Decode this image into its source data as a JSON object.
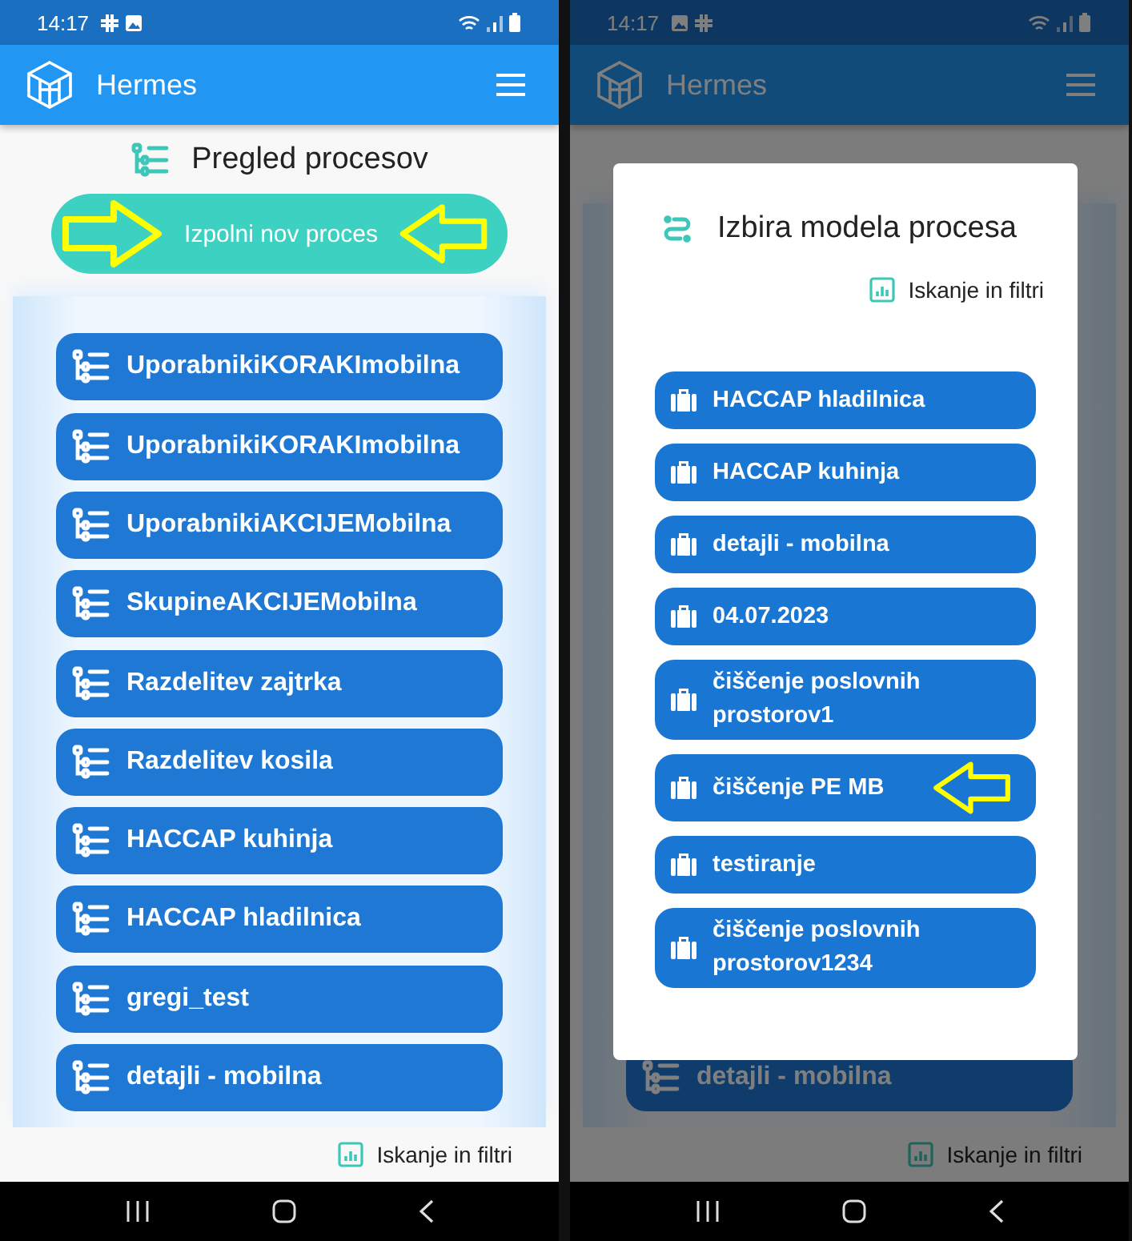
{
  "screens": [
    {
      "status_bar": {
        "time": "14:17",
        "notifications": [
          {
            "kind": "grid"
          },
          {
            "kind": "image"
          }
        ]
      },
      "app_bar": {
        "title": "Hermes"
      },
      "page_title": "Pregled procesov",
      "new_process_button": {
        "label": "Izpolni nov proces",
        "marked_with_arrows": true
      },
      "processes": [
        "UporabnikiKORAKImobilna",
        "UporabnikiKORAKImobilna",
        "UporabnikiAKCIJEMobilna",
        "SkupineAKCIJEMobilna",
        "Razdelitev zajtrka",
        "Razdelitev kosila",
        "HACCAP kuhinja",
        "HACCAP hladilnica",
        "gregi_test",
        "detajli - mobilna"
      ],
      "search_link": "Iskanje in filtri"
    },
    {
      "status_bar": {
        "time": "14:17",
        "notifications": [
          {
            "kind": "image"
          },
          {
            "kind": "grid"
          }
        ]
      },
      "app_bar": {
        "title": "Hermes"
      },
      "processes": [
        "detajli - mobilna"
      ],
      "search_link": "Iskanje in filtri",
      "dialog": {
        "title": "Izbira modela procesa",
        "search_link": "Iskanje in filtri",
        "models": [
          {
            "label": "HACCAP hladilnica",
            "marked_with_arrow": false
          },
          {
            "label": "HACCAP kuhinja",
            "marked_with_arrow": false
          },
          {
            "label": "detajli - mobilna",
            "marked_with_arrow": false
          },
          {
            "label": "04.07.2023",
            "marked_with_arrow": false
          },
          {
            "label": "čiščenje poslovnih prostorov1",
            "marked_with_arrow": false
          },
          {
            "label": "čiščenje PE MB",
            "marked_with_arrow": true
          },
          {
            "label": "testiranje",
            "marked_with_arrow": false
          },
          {
            "label": "čiščenje poslovnih prostorov1234",
            "marked_with_arrow": false
          }
        ]
      }
    }
  ]
}
